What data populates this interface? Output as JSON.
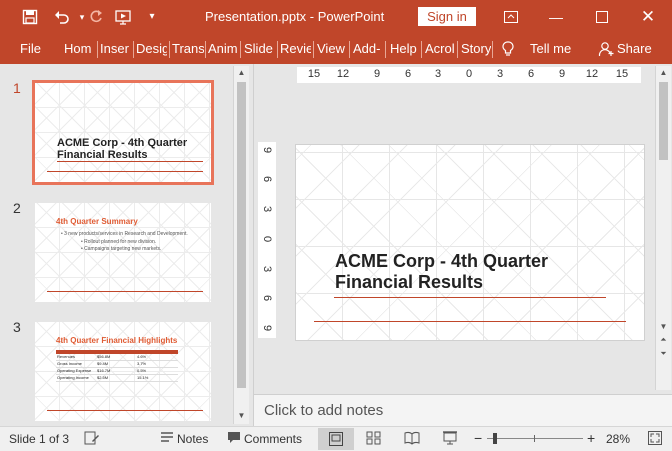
{
  "window": {
    "title": "Presentation.pptx  -  PowerPoint",
    "sign_in": "Sign in",
    "qa_icons": [
      "save-icon",
      "undo-icon",
      "redo-icon",
      "start-from-beginning-icon",
      "customize-icon"
    ]
  },
  "ribbon": {
    "tabs": [
      "File",
      "Hom",
      "Inser",
      "Desig",
      "Trans",
      "Anim",
      "Slide",
      "Revie",
      "View",
      "Add-",
      "Help",
      "Acrol",
      "Story"
    ],
    "tell_me": "Tell me",
    "share": "Share"
  },
  "slides": [
    {
      "num": "1",
      "title": "ACME Corp - 4th Quarter Financial Results",
      "title_l1": "ACME Corp - 4th Quarter",
      "title_l2": "Financial Results"
    },
    {
      "num": "2",
      "title": "4th Quarter Summary",
      "bullets": [
        "• 3 new products/services in Research and Development.",
        "• Rollout planned for new division.",
        "• Campaigns targeting new markets."
      ]
    },
    {
      "num": "3",
      "title": "4th Quarter Financial Highlights",
      "table_rows": [
        [
          "Revenues",
          "$56.8M",
          "4.6%"
        ],
        [
          "Gross Income",
          "$9.4M",
          "3.7%"
        ],
        [
          "Operating Expense",
          "$16.7M",
          "0.5%"
        ],
        [
          "Operating Income",
          "$2.5M",
          "15.1%"
        ]
      ]
    }
  ],
  "ruler": {
    "h": [
      "15",
      "12",
      "9",
      "6",
      "3",
      "0",
      "3",
      "6",
      "9",
      "12",
      "15"
    ],
    "v": [
      "9",
      "6",
      "3",
      "0",
      "3",
      "6",
      "9"
    ]
  },
  "editor": {
    "title_l1": "ACME Corp - 4th Quarter",
    "title_l2": "Financial Results",
    "notes_placeholder": "Click to add notes"
  },
  "status": {
    "slide_info": "Slide 1 of 3",
    "notes": "Notes",
    "comments": "Comments",
    "zoom": "28%"
  },
  "colors": {
    "accent": "#c0462a",
    "thumb_selected": "#e8745a"
  }
}
